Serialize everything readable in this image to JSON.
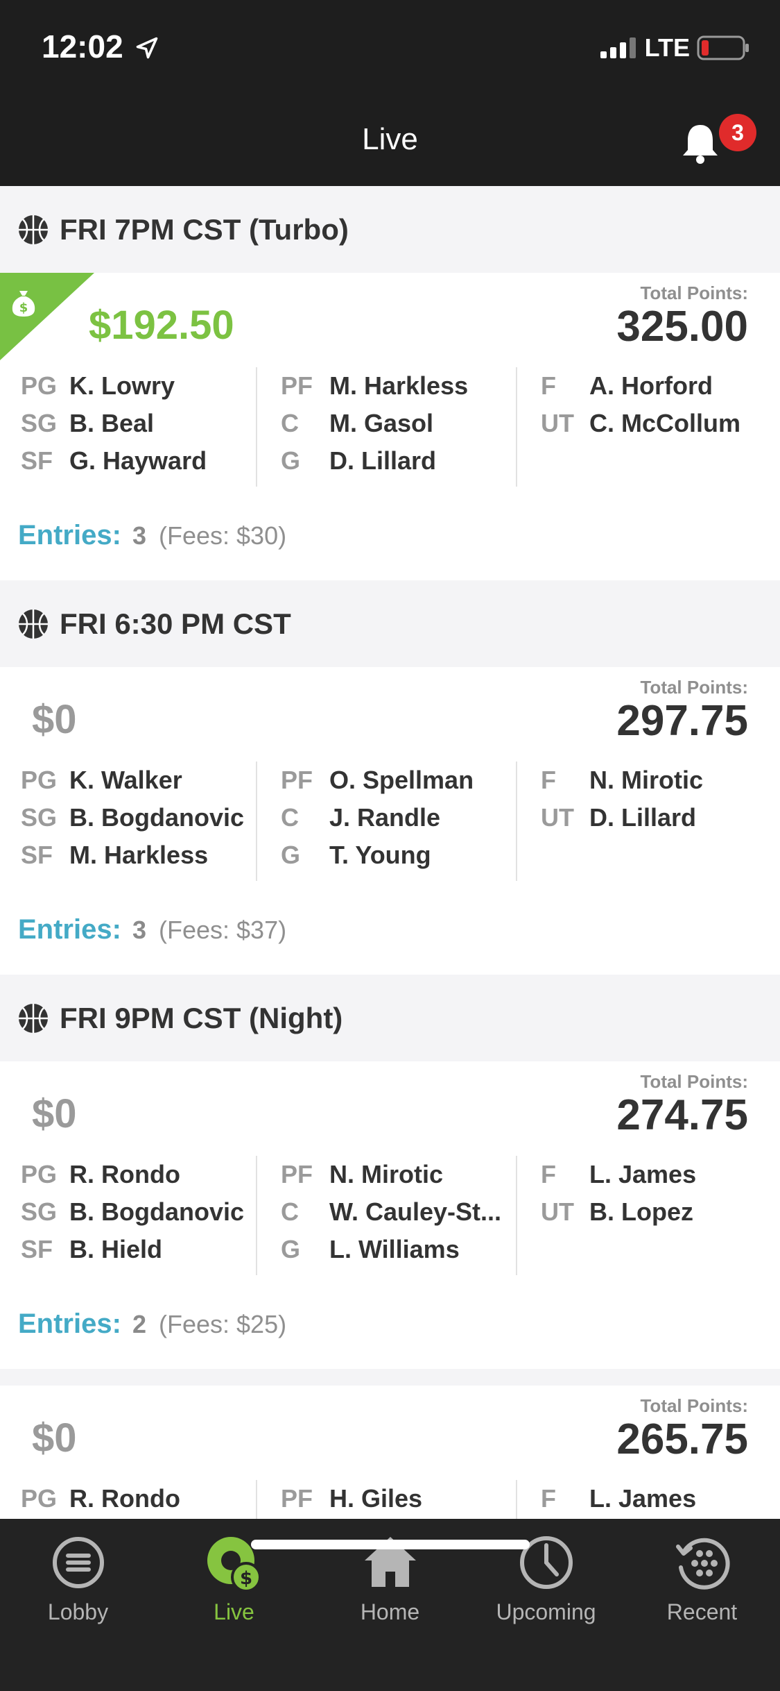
{
  "status": {
    "time": "12:02",
    "network": "LTE"
  },
  "nav": {
    "title": "Live",
    "notification_count": "3"
  },
  "contests": [
    {
      "title": "FRI 7PM CST  (Turbo)",
      "winnings": "$192.50",
      "winning": true,
      "total_points_label": "Total Points:",
      "total_points": "325.00",
      "roster": [
        [
          {
            "pos": "PG",
            "name": "K. Lowry"
          },
          {
            "pos": "SG",
            "name": "B. Beal"
          },
          {
            "pos": "SF",
            "name": "G. Hayward"
          }
        ],
        [
          {
            "pos": "PF",
            "name": "M. Harkless"
          },
          {
            "pos": "C",
            "name": "M. Gasol"
          },
          {
            "pos": "G",
            "name": "D. Lillard"
          }
        ],
        [
          {
            "pos": "F",
            "name": "A. Horford"
          },
          {
            "pos": "UT",
            "name": "C. McCollum"
          }
        ]
      ],
      "entries_label": "Entries:",
      "entries_count": "3",
      "fees": "(Fees: $30)"
    },
    {
      "title": "FRI 6:30 PM CST",
      "winnings": "$0",
      "winning": false,
      "total_points_label": "Total Points:",
      "total_points": "297.75",
      "roster": [
        [
          {
            "pos": "PG",
            "name": "K. Walker"
          },
          {
            "pos": "SG",
            "name": "B. Bogdanovic"
          },
          {
            "pos": "SF",
            "name": "M. Harkless"
          }
        ],
        [
          {
            "pos": "PF",
            "name": "O. Spellman"
          },
          {
            "pos": "C",
            "name": "J. Randle"
          },
          {
            "pos": "G",
            "name": "T. Young"
          }
        ],
        [
          {
            "pos": "F",
            "name": "N. Mirotic"
          },
          {
            "pos": "UT",
            "name": "D. Lillard"
          }
        ]
      ],
      "entries_label": "Entries:",
      "entries_count": "3",
      "fees": "(Fees: $37)"
    },
    {
      "title": "FRI 9PM CST  (Night)",
      "winnings": "$0",
      "winning": false,
      "total_points_label": "Total Points:",
      "total_points": "274.75",
      "roster": [
        [
          {
            "pos": "PG",
            "name": "R. Rondo"
          },
          {
            "pos": "SG",
            "name": "B. Bogdanovic"
          },
          {
            "pos": "SF",
            "name": "B. Hield"
          }
        ],
        [
          {
            "pos": "PF",
            "name": "N. Mirotic"
          },
          {
            "pos": "C",
            "name": "W. Cauley-St..."
          },
          {
            "pos": "G",
            "name": "L. Williams"
          }
        ],
        [
          {
            "pos": "F",
            "name": "L. James"
          },
          {
            "pos": "UT",
            "name": "B. Lopez"
          }
        ]
      ],
      "entries_label": "Entries:",
      "entries_count": "2",
      "fees": "(Fees: $25)"
    },
    {
      "winnings": "$0",
      "winning": false,
      "total_points_label": "Total Points:",
      "total_points": "265.75",
      "roster": [
        [
          {
            "pos": "PG",
            "name": "R. Rondo"
          }
        ],
        [
          {
            "pos": "PF",
            "name": "H. Giles"
          }
        ],
        [
          {
            "pos": "F",
            "name": "L. James"
          }
        ]
      ]
    }
  ],
  "tabs": [
    {
      "label": "Lobby",
      "icon": "lobby-icon",
      "active": false
    },
    {
      "label": "Live",
      "icon": "live-icon",
      "active": true
    },
    {
      "label": "Home",
      "icon": "home-icon",
      "active": false
    },
    {
      "label": "Upcoming",
      "icon": "upcoming-icon",
      "active": false
    },
    {
      "label": "Recent",
      "icon": "recent-icon",
      "active": false
    }
  ],
  "colors": {
    "accent_green": "#7cc242",
    "entries_blue": "#44aac6",
    "badge_red": "#e02b2b",
    "dark_bar": "#1e1e1e"
  }
}
